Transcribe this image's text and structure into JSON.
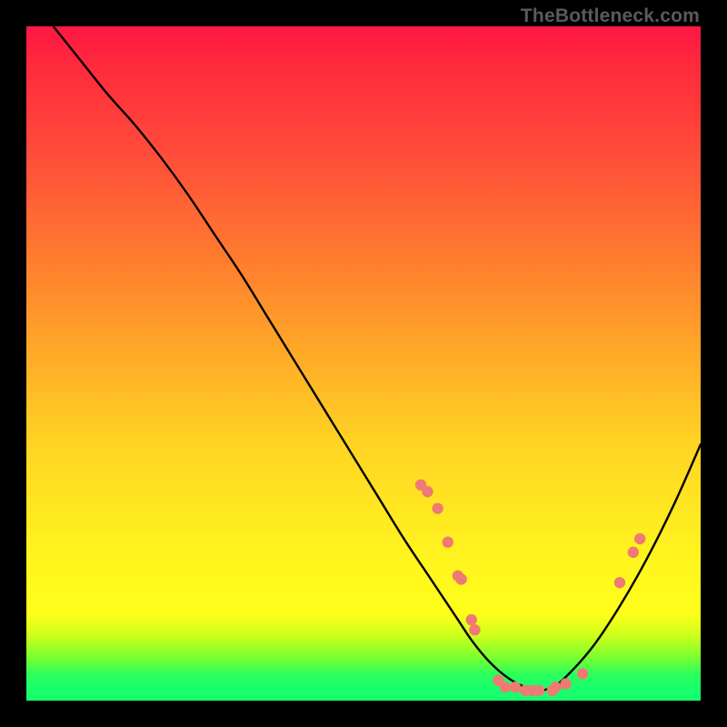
{
  "watermark": "TheBottleneck.com",
  "colors": {
    "background": "#000000",
    "curve_stroke": "#000000",
    "marker_fill": "#ef7a74",
    "gradient_top": "#ff1744",
    "gradient_mid": "#ffd423",
    "gradient_bottom": "#17ff6e"
  },
  "chart_data": {
    "type": "line",
    "title": "",
    "xlabel": "",
    "ylabel": "",
    "xlim": [
      0,
      100
    ],
    "ylim": [
      0,
      100
    ],
    "grid": false,
    "legend": false,
    "series": [
      {
        "name": "curve",
        "x": [
          4,
          8,
          12,
          16,
          20,
          24,
          28,
          32,
          36,
          40,
          44,
          48,
          52,
          56,
          60,
          62,
          64,
          66,
          68,
          70,
          72,
          74,
          76,
          78,
          80,
          84,
          88,
          92,
          96,
          100
        ],
        "y": [
          100,
          95,
          90,
          85.5,
          80.5,
          75,
          69,
          63,
          56.5,
          50,
          43.5,
          37,
          30.5,
          24,
          18,
          15,
          12,
          9,
          6.5,
          4.5,
          3,
          2,
          1.5,
          2,
          3.5,
          8,
          14,
          21,
          29,
          38
        ]
      }
    ],
    "markers": [
      {
        "x": 58.5,
        "y": 32
      },
      {
        "x": 59.5,
        "y": 31
      },
      {
        "x": 61,
        "y": 28.5
      },
      {
        "x": 62.5,
        "y": 23.5
      },
      {
        "x": 64,
        "y": 18.5
      },
      {
        "x": 64.5,
        "y": 18
      },
      {
        "x": 66,
        "y": 12
      },
      {
        "x": 66.5,
        "y": 10.5
      },
      {
        "x": 70,
        "y": 3
      },
      {
        "x": 71,
        "y": 2
      },
      {
        "x": 72.5,
        "y": 2
      },
      {
        "x": 74,
        "y": 1.5
      },
      {
        "x": 75,
        "y": 1.5
      },
      {
        "x": 76,
        "y": 1.5
      },
      {
        "x": 78,
        "y": 1.5
      },
      {
        "x": 78.5,
        "y": 2
      },
      {
        "x": 80,
        "y": 2.5
      },
      {
        "x": 82.5,
        "y": 4
      },
      {
        "x": 88,
        "y": 17.5
      },
      {
        "x": 90,
        "y": 22
      },
      {
        "x": 91,
        "y": 24
      }
    ]
  }
}
